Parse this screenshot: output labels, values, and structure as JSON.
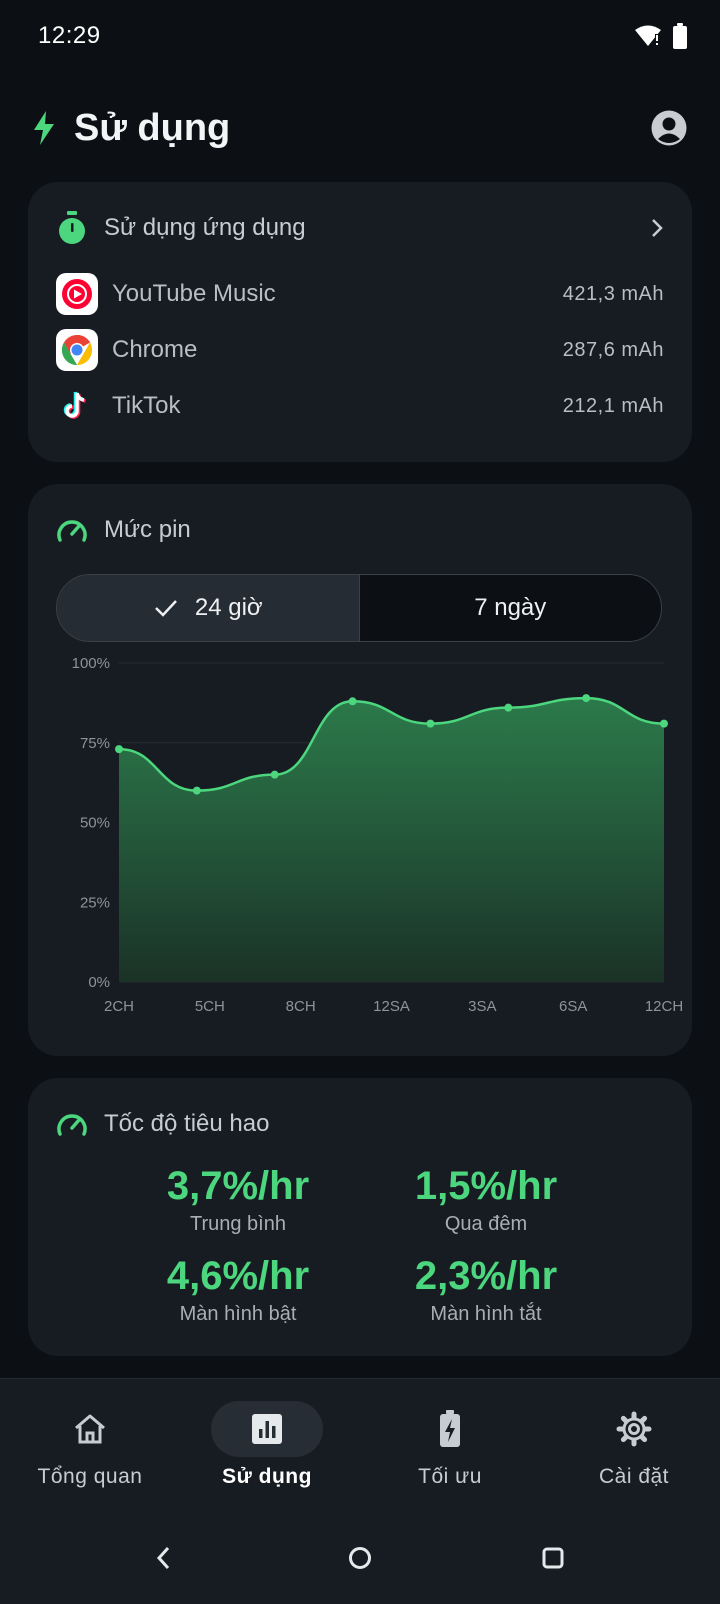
{
  "status_bar": {
    "time": "12:29"
  },
  "header": {
    "title": "Sử dụng"
  },
  "app_usage": {
    "title": "Sử dụng ứng dụng",
    "apps": [
      {
        "name": "YouTube Music",
        "value": "421,3 mAh",
        "icon": "youtube-music-icon"
      },
      {
        "name": "Chrome",
        "value": "287,6 mAh",
        "icon": "chrome-icon"
      },
      {
        "name": "TikTok",
        "value": "212,1 mAh",
        "icon": "tiktok-icon"
      }
    ]
  },
  "battery_level": {
    "title": "Mức pin",
    "range_selected": "24 giờ",
    "range_other": "7 ngày"
  },
  "chart_data": {
    "type": "area",
    "x": [
      "2CH",
      "",
      "5CH",
      "",
      "8CH",
      "",
      "12SA",
      "",
      "3SA",
      "",
      "6SA",
      "",
      "12CH"
    ],
    "categories": [
      "2CH",
      "5CH",
      "8CH",
      "12SA",
      "3SA",
      "6SA",
      "12CH"
    ],
    "y_ticks": [
      "100%",
      "75%",
      "50%",
      "25%",
      "0%"
    ],
    "points": [
      {
        "x": 0,
        "y": 73
      },
      {
        "x": 1,
        "y": 60
      },
      {
        "x": 2,
        "y": 65
      },
      {
        "x": 3,
        "y": 88
      },
      {
        "x": 4,
        "y": 81
      },
      {
        "x": 5,
        "y": 86
      },
      {
        "x": 6,
        "y": 89
      },
      {
        "x": 7,
        "y": 81
      }
    ],
    "ylim": [
      0,
      100
    ],
    "grid": true,
    "color": "#4cd67e"
  },
  "drain_rate": {
    "title": "Tốc độ tiêu hao",
    "metrics": [
      {
        "value": "3,7%/hr",
        "label": "Trung bình"
      },
      {
        "value": "1,5%/hr",
        "label": "Qua đêm"
      },
      {
        "value": "4,6%/hr",
        "label": "Màn hình bật"
      },
      {
        "value": "2,3%/hr",
        "label": "Màn hình tắt"
      }
    ]
  },
  "nav": {
    "items": [
      {
        "label": "Tổng quan",
        "icon": "home-icon"
      },
      {
        "label": "Sử dụng",
        "icon": "bar-chart-icon",
        "active": true
      },
      {
        "label": "Tối ưu",
        "icon": "battery-bolt-icon"
      },
      {
        "label": "Cài đặt",
        "icon": "gear-icon"
      }
    ]
  },
  "colors": {
    "accent": "#4cd67e",
    "background": "#0c1014",
    "card": "#171c22"
  }
}
